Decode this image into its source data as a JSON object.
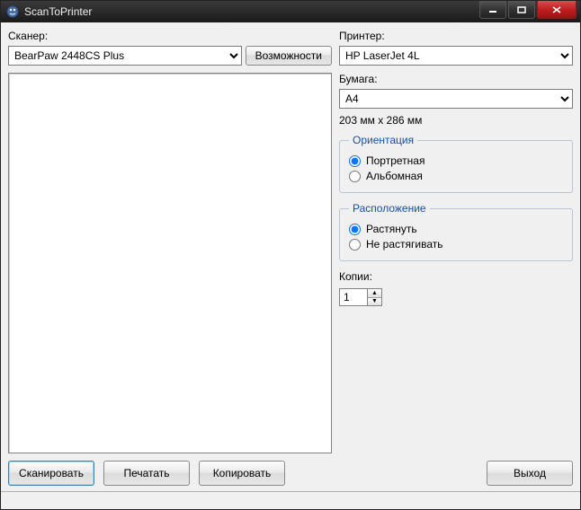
{
  "window": {
    "title": "ScanToPrinter"
  },
  "scanner": {
    "label": "Сканер:",
    "selected": "BearPaw 2448CS Plus",
    "capabilities_btn": "Возможности"
  },
  "printer": {
    "label": "Принтер:",
    "selected": "HP LaserJet 4L"
  },
  "paper": {
    "label": "Бумага:",
    "selected": "A4",
    "dimensions": "203 мм x 286 мм"
  },
  "orientation": {
    "legend": "Ориентация",
    "portrait": "Портретная",
    "landscape": "Альбомная",
    "selected": "portrait"
  },
  "layout": {
    "legend": "Расположение",
    "stretch": "Растянуть",
    "no_stretch": "Не растягивать",
    "selected": "stretch"
  },
  "copies": {
    "label": "Копии:",
    "value": "1"
  },
  "buttons": {
    "scan": "Сканировать",
    "print": "Печатать",
    "copy": "Копировать",
    "exit": "Выход"
  }
}
